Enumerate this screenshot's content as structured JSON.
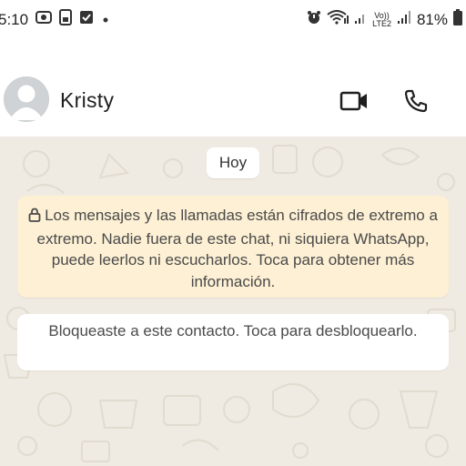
{
  "status_bar": {
    "time": "5:10",
    "network_label_top": "Vo))",
    "network_label_bottom": "LTE2",
    "battery": "81%"
  },
  "header": {
    "contact_name": "Kristy",
    "icons": [
      "avatar",
      "video-call-icon",
      "voice-call-icon"
    ]
  },
  "chat": {
    "date_chip": "Hoy",
    "encryption_notice": "Los mensajes y las llamadas están cifrados de extremo a extremo. Nadie fuera de este chat, ni siquiera WhatsApp, puede leerlos ni escucharlos. Toca para obtener más información.",
    "blocked_notice": "Bloqueaste a este contacto. Toca para desbloquearlo.",
    "colors": {
      "background": "#efeae2",
      "encryption_bubble": "#fdf0d4",
      "system_bubble": "#ffffff"
    }
  }
}
